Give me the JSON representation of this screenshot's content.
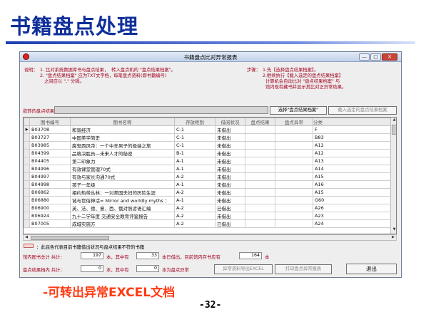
{
  "slide": {
    "title": "书籍盘点处理",
    "caption": "-可转出异常EXCEL文档",
    "page_number": "-32-"
  },
  "window": {
    "title": "书籍盘点比对异常报表",
    "controls": {
      "minimize": "—",
      "maximize": "□",
      "close": "✕"
    },
    "icon": "app-icon"
  },
  "instructions": {
    "label": "说明：",
    "lines": [
      "1. 比对系统数据库书与盘点结果，  转入盘点机的 \"盘点结果档案\"。",
      "2. \"盘点结果档案\" 应为TXT文字档，每笔盘点资料(即书籍编号)",
      "   之间应以 \",\" 分隔。"
    ]
  },
  "steps": {
    "label": "步骤：",
    "lines": [
      "1.先【选择盘点结果档案】。",
      "2.继续执行【载入选定的盘点结果档案】",
      "  计算机会自动比对 \"盘点结果档案\" 与",
      "  馆内现有藏书并显示其比对正异常结果。"
    ]
  },
  "file_selector": {
    "label": "欲转的盘点结果档：",
    "value": "",
    "select_button": "选择\"盘点结果档案\"",
    "load_button": "载入选定的盘点结果档案"
  },
  "grid": {
    "columns": [
      "图书编号",
      "图书名称",
      "存放柜别",
      "借阅状况",
      "盘点结果",
      "盘点异常",
      "分类"
    ],
    "rows": [
      {
        "id": "B03708",
        "name": "和谐经济",
        "shelf": "C-1",
        "status": "未借出",
        "result": "",
        "anomaly": "",
        "cat": "F",
        "current": true
      },
      {
        "id": "B03727",
        "name": "中国美学简史",
        "shelf": "C-1",
        "status": "未借出",
        "result": "",
        "anomaly": "",
        "cat": "B83"
      },
      {
        "id": "B03985",
        "name": "腐鬼西风帝：一个中年男子的极端之旅",
        "shelf": "C-1",
        "status": "未借出",
        "result": "",
        "anomaly": "",
        "cat": "A12"
      },
      {
        "id": "B04399",
        "name": "品格决胜员—未来人才的秘密",
        "shelf": "B-1",
        "status": "未借出",
        "result": "",
        "anomaly": "",
        "cat": "A12"
      },
      {
        "id": "B04405",
        "name": "第二印象力",
        "shelf": "A-1",
        "status": "未借出",
        "result": "",
        "anomaly": "",
        "cat": "A13"
      },
      {
        "id": "B04996",
        "name": "有效课堂管理70式",
        "shelf": "A-1",
        "status": "未借出",
        "result": "",
        "anomaly": "",
        "cat": "A14"
      },
      {
        "id": "B04997",
        "name": "有效与家长沟通70式",
        "shelf": "A-2",
        "status": "未借出",
        "result": "",
        "anomaly": "",
        "cat": "A15"
      },
      {
        "id": "B04998",
        "name": "孩子一年级",
        "shelf": "A-1",
        "status": "未借出",
        "result": "",
        "anomaly": "",
        "cat": "A16"
      },
      {
        "id": "B06862",
        "name": "相约热带丛林：一对美国夫妇的历险生涯",
        "shelf": "A-2",
        "status": "未借出",
        "result": "",
        "anomaly": "",
        "cat": "A15"
      },
      {
        "id": "B06880",
        "name": "诚与世俗神话= Mirror and worldly myths ：",
        "shelf": "A-1",
        "status": "未借出",
        "result": "",
        "anomaly": "",
        "cat": "G60"
      },
      {
        "id": "B06900",
        "name": "英、法、德、意、西、俄对照谚语汇编",
        "shelf": "A-2",
        "status": "已借出",
        "result": "",
        "anomaly": "",
        "cat": "A26"
      },
      {
        "id": "B06924",
        "name": "九十二学年度 交通安全教育评鉴报告",
        "shelf": "A-2",
        "status": "未借出",
        "result": "",
        "anomaly": "",
        "cat": "A23"
      },
      {
        "id": "B07005",
        "name": "成城实施方",
        "shelf": "A-2",
        "status": "已借出",
        "result": "",
        "anomaly": "",
        "cat": "A24"
      }
    ]
  },
  "legend": {
    "text": "：此底色代表目前书籍借出状况与盘点结果不符的书籍",
    "color": "#f4d8d8"
  },
  "stats": {
    "row1": {
      "label": "馆内图书总计 共计：",
      "total": "197",
      "unit1": "本，其中有",
      "borrowed": "33",
      "unit2": "本已借出，目前馆内存书应有",
      "present": "164",
      "unit3": "本"
    },
    "row2": {
      "label": "盘点结果档内 共计：",
      "total": "0",
      "unit1": "本，其中有",
      "anomaly": "0",
      "unit2": "本为盘点异常"
    }
  },
  "actions": {
    "export_excel": "异常资料导出EXCEL",
    "print_report": "打印盘点异常报表",
    "exit": "退出"
  }
}
